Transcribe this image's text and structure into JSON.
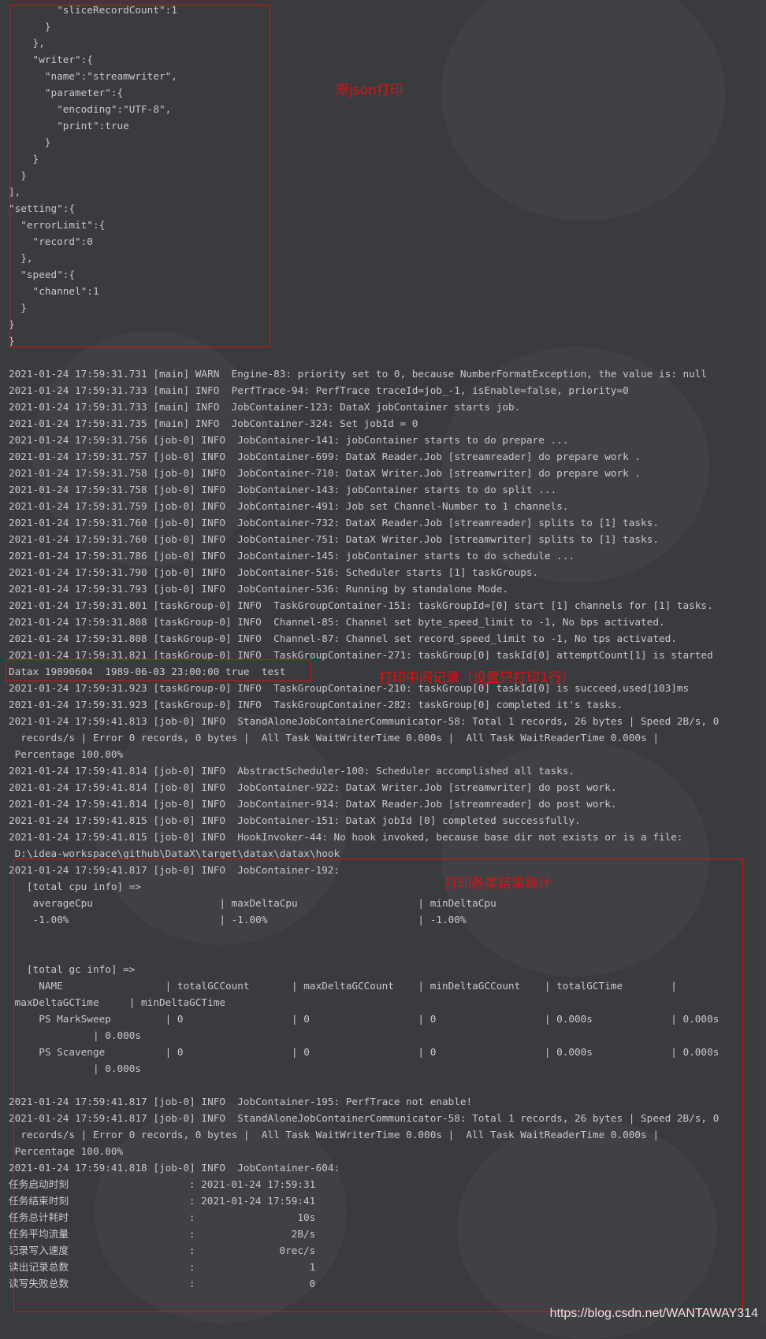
{
  "console": {
    "lines": [
      "        \"sliceRecordCount\":1",
      "      }",
      "    },",
      "    \"writer\":{",
      "      \"name\":\"streamwriter\",",
      "      \"parameter\":{",
      "        \"encoding\":\"UTF-8\",",
      "        \"print\":true",
      "      }",
      "    }",
      "  }",
      "],",
      "\"setting\":{",
      "  \"errorLimit\":{",
      "    \"record\":0",
      "  },",
      "  \"speed\":{",
      "    \"channel\":1",
      "  }",
      "}",
      "}",
      "",
      "2021-01-24 17:59:31.731 [main] WARN  Engine-83: priority set to 0, because NumberFormatException, the value is: null",
      "2021-01-24 17:59:31.733 [main] INFO  PerfTrace-94: PerfTrace traceId=job_-1, isEnable=false, priority=0",
      "2021-01-24 17:59:31.733 [main] INFO  JobContainer-123: DataX jobContainer starts job.",
      "2021-01-24 17:59:31.735 [main] INFO  JobContainer-324: Set jobId = 0",
      "2021-01-24 17:59:31.756 [job-0] INFO  JobContainer-141: jobContainer starts to do prepare ...",
      "2021-01-24 17:59:31.757 [job-0] INFO  JobContainer-699: DataX Reader.Job [streamreader] do prepare work .",
      "2021-01-24 17:59:31.758 [job-0] INFO  JobContainer-710: DataX Writer.Job [streamwriter] do prepare work .",
      "2021-01-24 17:59:31.758 [job-0] INFO  JobContainer-143: jobContainer starts to do split ...",
      "2021-01-24 17:59:31.759 [job-0] INFO  JobContainer-491: Job set Channel-Number to 1 channels.",
      "2021-01-24 17:59:31.760 [job-0] INFO  JobContainer-732: DataX Reader.Job [streamreader] splits to [1] tasks.",
      "2021-01-24 17:59:31.760 [job-0] INFO  JobContainer-751: DataX Writer.Job [streamwriter] splits to [1] tasks.",
      "2021-01-24 17:59:31.786 [job-0] INFO  JobContainer-145: jobContainer starts to do schedule ...",
      "2021-01-24 17:59:31.790 [job-0] INFO  JobContainer-516: Scheduler starts [1] taskGroups.",
      "2021-01-24 17:59:31.793 [job-0] INFO  JobContainer-536: Running by standalone Mode.",
      "2021-01-24 17:59:31.801 [taskGroup-0] INFO  TaskGroupContainer-151: taskGroupId=[0] start [1] channels for [1] tasks.",
      "2021-01-24 17:59:31.808 [taskGroup-0] INFO  Channel-85: Channel set byte_speed_limit to -1, No bps activated.",
      "2021-01-24 17:59:31.808 [taskGroup-0] INFO  Channel-87: Channel set record_speed_limit to -1, No tps activated.",
      "2021-01-24 17:59:31.821 [taskGroup-0] INFO  TaskGroupContainer-271: taskGroup[0] taskId[0] attemptCount[1] is started",
      "Datax 19890604  1989-06-03 23:00:00 true  test",
      "2021-01-24 17:59:31.923 [taskGroup-0] INFO  TaskGroupContainer-210: taskGroup[0] taskId[0] is succeed,used[103]ms",
      "2021-01-24 17:59:31.923 [taskGroup-0] INFO  TaskGroupContainer-282: taskGroup[0] completed it's tasks.",
      "2021-01-24 17:59:41.813 [job-0] INFO  StandAloneJobContainerCommunicator-58: Total 1 records, 26 bytes | Speed 2B/s, 0",
      "  records/s | Error 0 records, 0 bytes |  All Task WaitWriterTime 0.000s |  All Task WaitReaderTime 0.000s |",
      " Percentage 100.00%",
      "2021-01-24 17:59:41.814 [job-0] INFO  AbstractScheduler-100: Scheduler accomplished all tasks.",
      "2021-01-24 17:59:41.814 [job-0] INFO  JobContainer-922: DataX Writer.Job [streamwriter] do post work.",
      "2021-01-24 17:59:41.814 [job-0] INFO  JobContainer-914: DataX Reader.Job [streamreader] do post work.",
      "2021-01-24 17:59:41.815 [job-0] INFO  JobContainer-151: DataX jobId [0] completed successfully.",
      "2021-01-24 17:59:41.815 [job-0] INFO  HookInvoker-44: No hook invoked, because base dir not exists or is a file:",
      " D:\\idea-workspace\\github\\DataX\\target\\datax\\datax\\hook",
      "2021-01-24 17:59:41.817 [job-0] INFO  JobContainer-192:",
      "   [total cpu info] =>",
      "    averageCpu                     | maxDeltaCpu                    | minDeltaCpu",
      "    -1.00%                         | -1.00%                         | -1.00%",
      "",
      "",
      "   [total gc info] =>",
      "     NAME                 | totalGCCount       | maxDeltaGCCount    | minDeltaGCCount    | totalGCTime        |",
      " maxDeltaGCTime     | minDeltaGCTime",
      "     PS MarkSweep         | 0                  | 0                  | 0                  | 0.000s             | 0.000s",
      "              | 0.000s",
      "     PS Scavenge          | 0                  | 0                  | 0                  | 0.000s             | 0.000s",
      "              | 0.000s",
      "",
      "2021-01-24 17:59:41.817 [job-0] INFO  JobContainer-195: PerfTrace not enable!",
      "2021-01-24 17:59:41.817 [job-0] INFO  StandAloneJobContainerCommunicator-58: Total 1 records, 26 bytes | Speed 2B/s, 0",
      "  records/s | Error 0 records, 0 bytes |  All Task WaitWriterTime 0.000s |  All Task WaitReaderTime 0.000s |",
      " Percentage 100.00%",
      "2021-01-24 17:59:41.818 [job-0] INFO  JobContainer-604:",
      "任务启动时刻                    : 2021-01-24 17:59:31",
      "任务结束时刻                    : 2021-01-24 17:59:41",
      "任务总计耗时                    :                 10s",
      "任务平均流量                    :                2B/s",
      "记录写入速度                    :              0rec/s",
      "读出记录总数                    :                   1",
      "读写失败总数                    :                   0"
    ]
  },
  "annotations": {
    "json": "原json打印",
    "record": "打印中间记录（设置只打印1行）",
    "stats": "打印各类结果统计"
  },
  "watermark": "https://blog.csdn.net/WANTAWAY314",
  "colors": {
    "background": "#3a3b3e",
    "text": "#c6c8cc",
    "annotation": "#e01010"
  }
}
